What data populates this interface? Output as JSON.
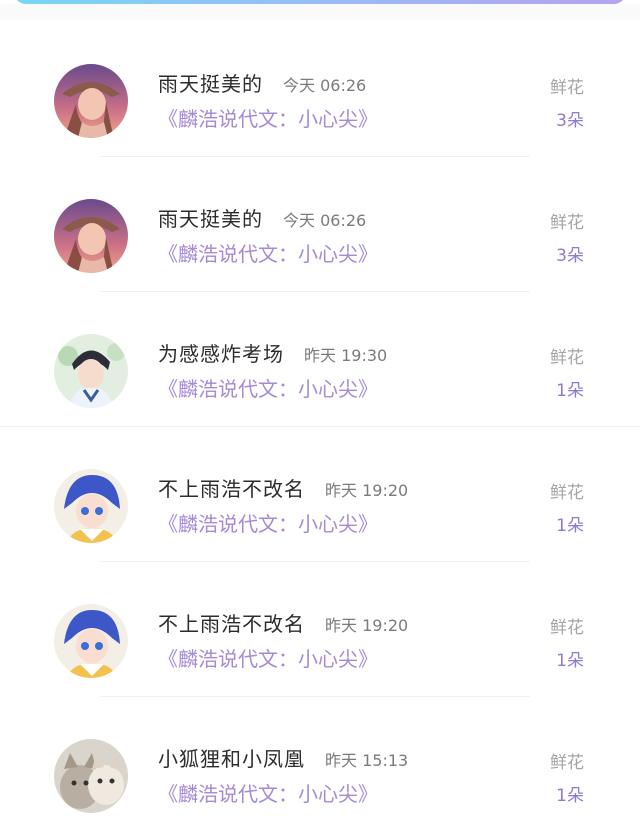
{
  "rows": [
    {
      "avatar": "avatar-girl-sunset",
      "username": "雨天挺美的",
      "time": "今天 06:26",
      "book": "《麟浩说代文：小心尖》",
      "gift_label": "鲜花",
      "gift_count": "3朵"
    },
    {
      "avatar": "avatar-girl-sunset",
      "username": "雨天挺美的",
      "time": "今天 06:26",
      "book": "《麟浩说代文：小心尖》",
      "gift_label": "鲜花",
      "gift_count": "3朵"
    },
    {
      "avatar": "avatar-boy-dark-hair",
      "username": "为感感炸考场",
      "time": "昨天 19:30",
      "book": "《麟浩说代文：小心尖》",
      "gift_label": "鲜花",
      "gift_count": "1朵"
    },
    {
      "avatar": "avatar-boy-blue-hair",
      "username": "不上雨浩不改名",
      "time": "昨天 19:20",
      "book": "《麟浩说代文：小心尖》",
      "gift_label": "鲜花",
      "gift_count": "1朵"
    },
    {
      "avatar": "avatar-boy-blue-hair",
      "username": "不上雨浩不改名",
      "time": "昨天 19:20",
      "book": "《麟浩说代文：小心尖》",
      "gift_label": "鲜花",
      "gift_count": "1朵"
    },
    {
      "avatar": "avatar-cats",
      "username": "小狐狸和小凤凰",
      "time": "昨天 15:13",
      "book": "《麟浩说代文：小心尖》",
      "gift_label": "鲜花",
      "gift_count": "1朵"
    }
  ]
}
